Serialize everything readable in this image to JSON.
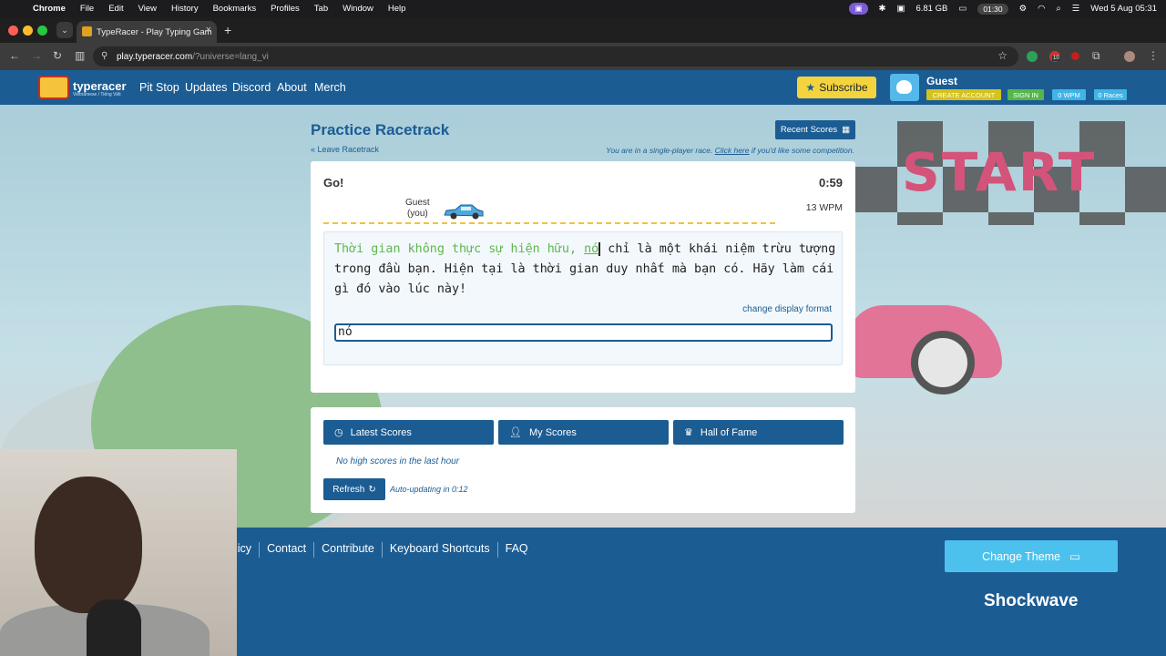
{
  "menubar": {
    "app": "Chrome",
    "items": [
      "File",
      "Edit",
      "View",
      "History",
      "Bookmarks",
      "Profiles",
      "Tab",
      "Window",
      "Help"
    ],
    "memory": "6.81 GB",
    "timer": "01:30",
    "datetime": "Wed 5 Aug  05:31"
  },
  "browser": {
    "tab_title": "TypeRacer - Play Typing Gam",
    "url_host": "play.typeracer.com",
    "url_path": "/?universe=lang_vi",
    "ext_badge": "10"
  },
  "header": {
    "logo": "typeracer",
    "logo_sub": "Vietnamese / Tiếng Việt",
    "nav": [
      "Pit Stop",
      "Updates",
      "Discord",
      "About",
      "Merch"
    ],
    "subscribe": "Subscribe",
    "user": "Guest",
    "create_account": "CREATE ACCOUNT",
    "sign_in": "SIGN IN",
    "wpm_badge": "0 WPM",
    "races_badge": "0 Races"
  },
  "race": {
    "title": "Practice Racetrack",
    "recent_scores": "Recent Scores",
    "leave": "« Leave Racetrack",
    "single_notice_pre": "You are in a single-player race.",
    "single_notice_link": "Click here",
    "single_notice_post": "if you'd like some competition.",
    "status": "Go!",
    "timer": "0:59",
    "racer_name": "Guest",
    "racer_you": "(you)",
    "wpm": "13 WPM",
    "typed_text": "Thời gian không thực sự hiện hữu,",
    "current_word": "nó",
    "remaining_text": " chỉ là một khái niệm trừu tượng trong đầu bạn. Hiện tại là thời gian duy nhất mà bạn có. Hãy làm cái gì đó vào lúc này!",
    "change_format": "change display format",
    "input_value": "nó"
  },
  "scores": {
    "tabs": [
      "Latest Scores",
      "My Scores",
      "Hall of Fame"
    ],
    "empty": "No high scores in the last hour",
    "refresh": "Refresh",
    "auto_update": "Auto-updating in 0:12"
  },
  "footer": {
    "links": [
      "licy",
      "Contact",
      "Contribute",
      "Keyboard Shortcuts",
      "FAQ"
    ],
    "change_theme": "Change Theme",
    "brand": "Shockwave"
  },
  "background": {
    "banner": "START"
  }
}
